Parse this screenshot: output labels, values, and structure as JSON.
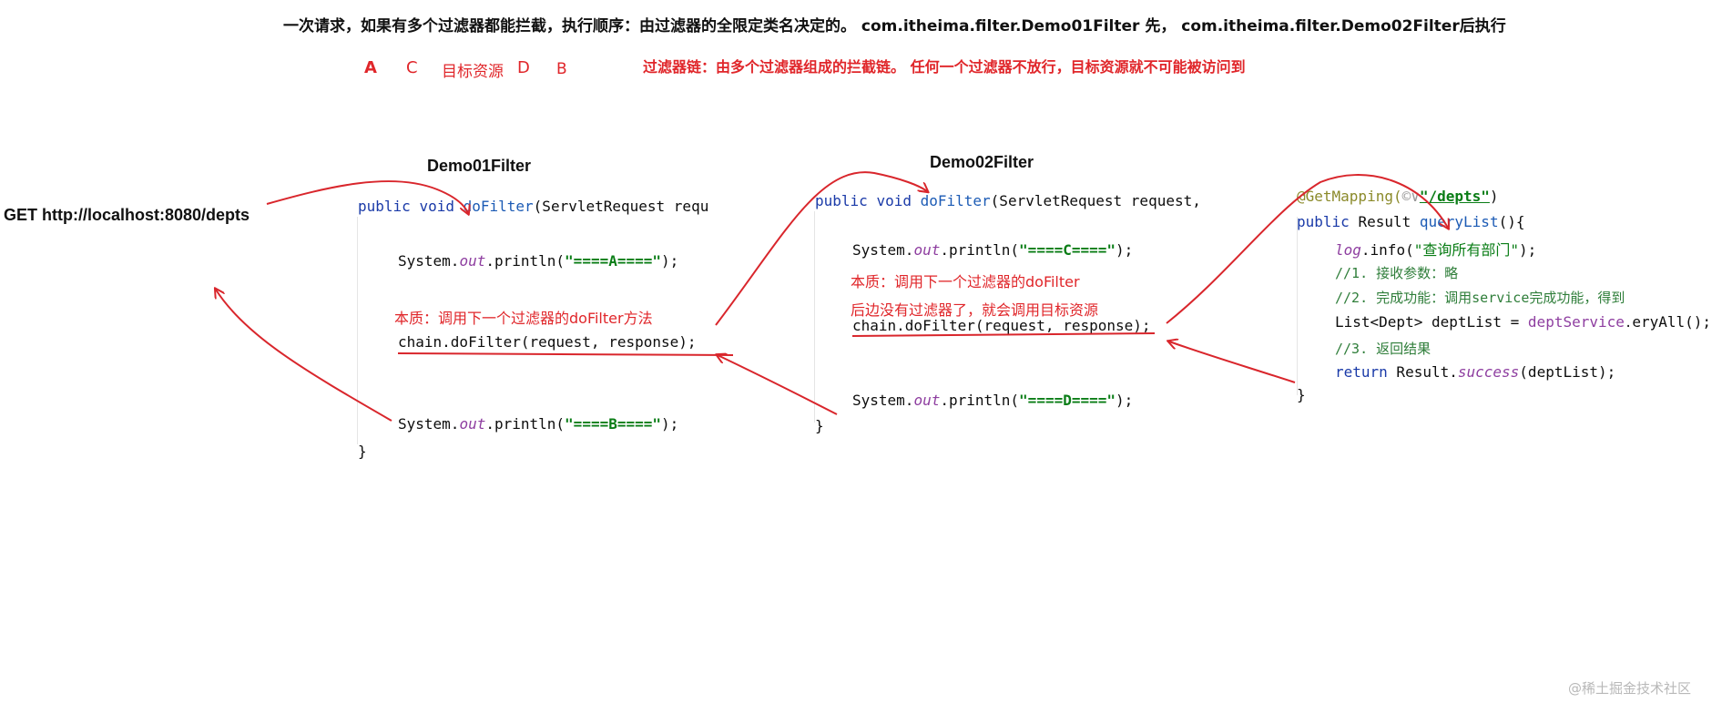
{
  "header": {
    "title": "一次请求，如果有多个过滤器都能拦截，执行顺序：由过滤器的全限定类名决定的。 com.itheima.filter.Demo01Filter 先， com.itheima.filter.Demo02Filter后执行",
    "order": {
      "a": "A",
      "c": "C",
      "target": "目标资源",
      "d": "D",
      "b": "B"
    },
    "chain_note": "过滤器链：由多个过滤器组成的拦截链。 任何一个过滤器不放行，目标资源就不可能被访问到"
  },
  "request": {
    "label": "GET http://localhost:8080/depts"
  },
  "filter1": {
    "name": "Demo01Filter",
    "sig_kw1": "public",
    "sig_kw2": "void",
    "sig_method": "doFilter",
    "sig_rest": "(ServletRequest requ",
    "print_a_pre": "System.",
    "print_out": "out",
    "print_a_mid": ".println(",
    "print_a_str": "\"====A====\"",
    "print_end": ");",
    "note": "本质：调用下一个过滤器的doFilter方法",
    "chain_call": "chain.doFilter(request, response);",
    "print_b_str": "\"====B====\"",
    "close_brace": "}"
  },
  "filter2": {
    "name": "Demo02Filter",
    "sig_rest": "(ServletRequest request,",
    "print_c_str": "\"====C====\"",
    "note1": "本质：调用下一个过滤器的doFilter",
    "note2": "后边没有过滤器了，就会调用目标资源",
    "chain_call": "chain.doFilter(request, response);",
    "print_d_str": "\"====D====\"",
    "close_brace": "}"
  },
  "controller": {
    "annotation": "@GetMapping(",
    "annotation_icon": "©∨",
    "annotation_path": "\"/depts\"",
    "annotation_end": ")",
    "sig_kw": "public",
    "sig_type": "Result",
    "sig_method": "queryList",
    "sig_end": "(){",
    "log_obj": "log",
    "log_call": ".info(",
    "log_str": "\"查询所有部门\"",
    "log_end": ");",
    "comment1": "//1. 接收参数：略",
    "comment2": "//2. 完成功能：调用service完成功能，得到",
    "list_decl": "List<Dept> deptList = ",
    "service": "deptService",
    "query_tail": "eryAll();",
    "comment3": "//3. 返回结果",
    "return_kw": "return",
    "return_rest": " Result.",
    "success": "success",
    "return_args": "(deptList);",
    "close_brace": "}"
  },
  "watermark": "@稀土掘金技术社区",
  "colors": {
    "arrow_red": "#d9262c",
    "keyword_blue": "#1a3aa8",
    "string_green": "#0a7d16",
    "field_purple": "#8e3ea0"
  }
}
